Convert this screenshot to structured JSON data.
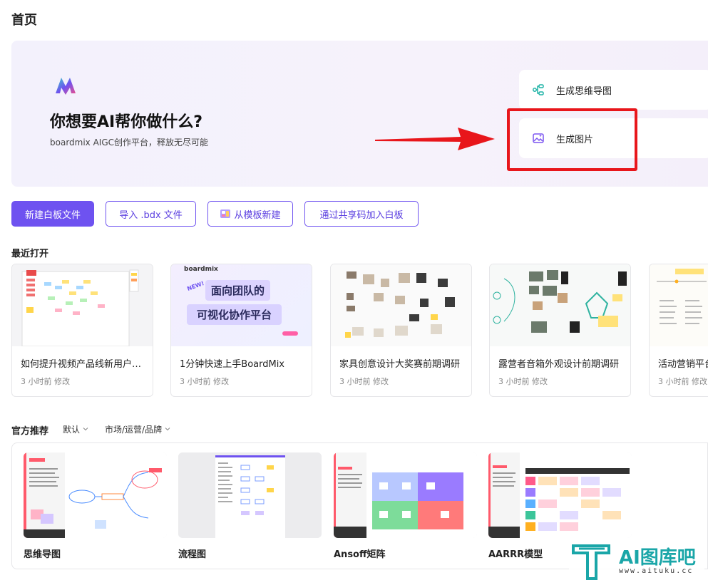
{
  "header": {
    "title": "首页"
  },
  "hero": {
    "title": "你想要AI帮你做什么?",
    "subtitle": "boardmix AIGC创作平台，释放无尽可能",
    "actions": [
      {
        "label": "生成思维导图",
        "icon": "mindmap-icon"
      },
      {
        "label": "生成图片",
        "icon": "image-icon"
      }
    ],
    "colors": {
      "highlight": "#e8161b",
      "accent": "#6e52f0"
    }
  },
  "toolbar": {
    "new_board": "新建白板文件",
    "import_bdx": "导入 .bdx 文件",
    "from_template": "从模板新建",
    "join_by_code": "通过共享码加入白板"
  },
  "recent": {
    "label": "最近打开",
    "items": [
      {
        "name": "如何提升视频产品线新用户留存",
        "time": "3 小时前 修改"
      },
      {
        "name": "1分钟快速上手BoardMix",
        "time": "3 小时前 修改",
        "thumb_brand": "boardmix",
        "thumb_new": "NEW!",
        "thumb_line1": "面向团队的",
        "thumb_line2": "可视化协作平台"
      },
      {
        "name": "家具创意设计大奖赛前期调研",
        "time": "3 小时前 修改"
      },
      {
        "name": "露营者音箱外观设计前期调研",
        "time": "3 小时前 修改"
      },
      {
        "name": "活动营销平台",
        "time": "3 小时前 修改"
      }
    ]
  },
  "recommend": {
    "label": "官方推荐",
    "filter_default": "默认",
    "filter_category": "市场/运营/品牌",
    "templates": [
      {
        "name": "思维导图"
      },
      {
        "name": "流程图"
      },
      {
        "name": "Ansoff矩阵"
      },
      {
        "name": "AARRR模型"
      }
    ]
  },
  "watermark": {
    "text": "AI图库吧",
    "url": "www.aituku.cc"
  }
}
